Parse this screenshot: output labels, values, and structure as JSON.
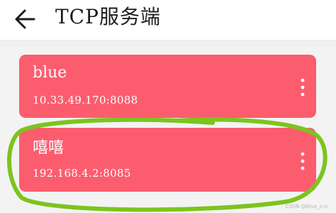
{
  "app_bar": {
    "title": "TCP服务端",
    "back_icon": "arrow-left-icon"
  },
  "servers": [
    {
      "name": "blue",
      "address": "10.33.49.170:8088",
      "menu_icon": "more-vertical-icon"
    },
    {
      "name": "嘻嘻",
      "address": "192.168.4.2:8085",
      "menu_icon": "more-vertical-icon"
    }
  ],
  "colors": {
    "card": "#fb5d6f",
    "highlight_stroke": "#7cc41e",
    "background": "#f3f3f3"
  },
  "watermark": "CSDN @Blue_o-o"
}
